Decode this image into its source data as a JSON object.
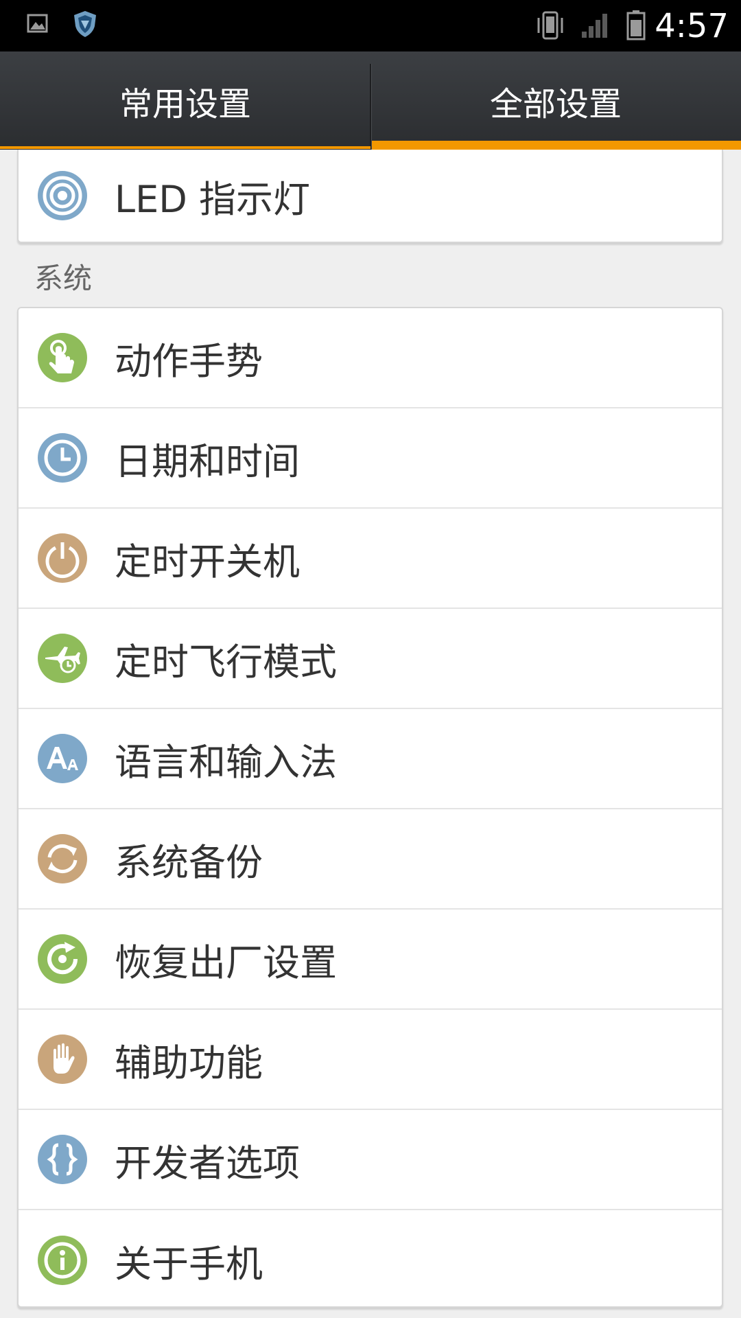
{
  "status_bar": {
    "time": "4:57",
    "icons": [
      "picture-icon",
      "shield-icon",
      "vibrate-icon",
      "signal-icon",
      "battery-icon"
    ]
  },
  "tabs": [
    {
      "label": "常用设置",
      "selected": false
    },
    {
      "label": "全部设置",
      "selected": true
    }
  ],
  "colors": {
    "accent": "#f39800",
    "blue": "#7fa8c9",
    "green": "#8fbc5a",
    "tan": "#c9a57b"
  },
  "top_item": {
    "label": "LED 指示灯",
    "icon": "led-icon"
  },
  "system_section": {
    "header": "系统",
    "items": [
      {
        "label": "动作手势",
        "icon": "gesture-icon"
      },
      {
        "label": "日期和时间",
        "icon": "clock-icon"
      },
      {
        "label": "定时开关机",
        "icon": "power-icon"
      },
      {
        "label": "定时飞行模式",
        "icon": "airplane-icon"
      },
      {
        "label": "语言和输入法",
        "icon": "language-icon"
      },
      {
        "label": "系统备份",
        "icon": "backup-icon"
      },
      {
        "label": "恢复出厂设置",
        "icon": "reset-icon"
      },
      {
        "label": "辅助功能",
        "icon": "accessibility-icon"
      },
      {
        "label": "开发者选项",
        "icon": "developer-icon"
      },
      {
        "label": "关于手机",
        "icon": "info-icon"
      }
    ]
  }
}
